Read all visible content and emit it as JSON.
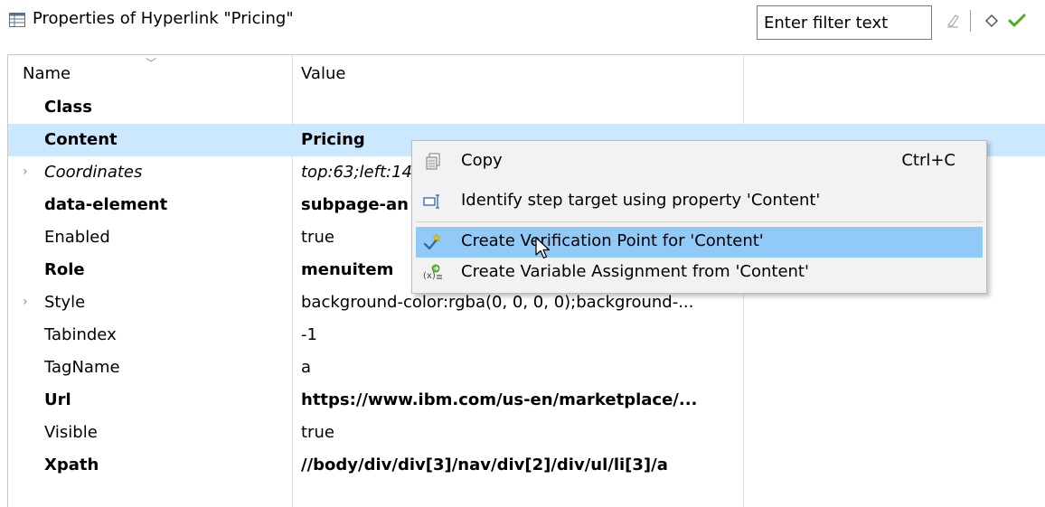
{
  "header": {
    "title": "Properties of Hyperlink \"Pricing\"",
    "filter_placeholder": "Enter filter text"
  },
  "table": {
    "columns": [
      "Name",
      "Value"
    ],
    "rows": [
      {
        "name": "Class",
        "value": "",
        "bold": true
      },
      {
        "name": "Content",
        "value": "Pricing",
        "bold": true,
        "selected": true
      },
      {
        "name": "Coordinates",
        "value": "top:63;left:14",
        "italic": true,
        "expandable": true
      },
      {
        "name": "data-element",
        "value": "subpage-an",
        "bold": true
      },
      {
        "name": "Enabled",
        "value": "true"
      },
      {
        "name": "Role",
        "value": "menuitem",
        "bold": true
      },
      {
        "name": "Style",
        "value": "background-color:rgba(0, 0, 0, 0);background-...",
        "expandable": true
      },
      {
        "name": "Tabindex",
        "value": "-1"
      },
      {
        "name": "TagName",
        "value": "a"
      },
      {
        "name": "Url",
        "value": "https://www.ibm.com/us-en/marketplace/...",
        "bold": true
      },
      {
        "name": "Visible",
        "value": "true"
      },
      {
        "name": "Xpath",
        "value": "//body/div/div[3]/nav/div[2]/div/ul/li[3]/a",
        "bold": true
      }
    ]
  },
  "context_menu": {
    "items": [
      {
        "label": "Copy",
        "shortcut": "Ctrl+C",
        "icon": "copy-icon"
      },
      {
        "label": "Identify step target using property 'Content'",
        "icon": "identify-target-icon"
      },
      {
        "label": "Create Verification Point for 'Content'",
        "icon": "verification-point-icon",
        "highlighted": true
      },
      {
        "label": "Create Variable Assignment from 'Content'",
        "icon": "variable-assignment-icon"
      }
    ]
  },
  "colors": {
    "selection": "#cce8ff",
    "menu_hover": "#91c9f7",
    "check_green": "#4caf1a"
  }
}
